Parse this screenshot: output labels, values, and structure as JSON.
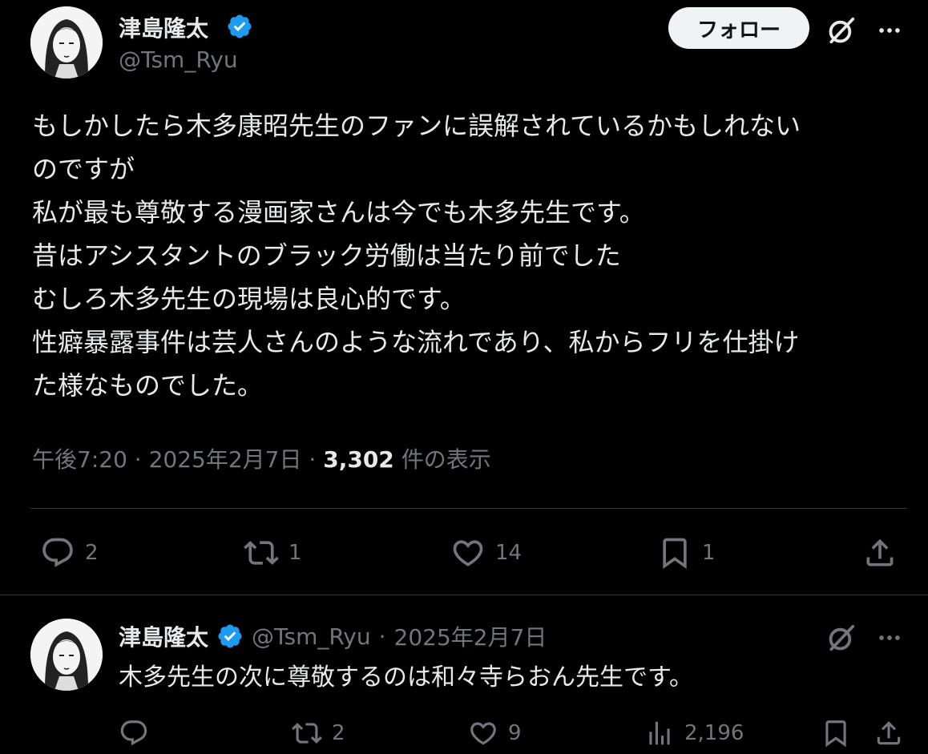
{
  "tweet": {
    "author_name": "津島隆太",
    "author_handle": "@Tsm_Ryu",
    "follow_label": "フォロー",
    "text_lines": [
      "もしかしたら木多康昭先生のファンに誤解されているかもしれない",
      "のですが",
      "私が最も尊敬する漫画家さんは今でも木多先生です。",
      "昔はアシスタントのブラック労働は当たり前でした",
      "むしろ木多先生の現場は良心的です。",
      "性癖暴露事件は芸人さんのような流れであり、私からフリを仕掛け",
      "た様なものでした。"
    ],
    "time": "午後7:20",
    "date": "2025年2月7日",
    "views_count": "3,302",
    "views_label": "件の表示",
    "separator": "·",
    "stats": {
      "replies": "2",
      "retweets": "1",
      "likes": "14",
      "bookmarks": "1"
    }
  },
  "reply": {
    "author_name": "津島隆太",
    "author_handle": "@Tsm_Ryu",
    "separator": "·",
    "date": "2025年2月7日",
    "text": "木多先生の次に尊敬するのは和々寺らおん先生です。",
    "stats": {
      "retweets": "2",
      "likes": "9",
      "views": "2,196"
    }
  },
  "colors": {
    "background": "#000000",
    "text": "#e7e9ea",
    "muted": "#71767b",
    "verified": "#1d9bf0",
    "divider": "#2f3336"
  },
  "icons": [
    "verified-badge-icon",
    "grok-icon",
    "more-icon",
    "reply-icon",
    "retweet-icon",
    "like-icon",
    "bookmark-icon",
    "share-icon",
    "views-icon"
  ]
}
